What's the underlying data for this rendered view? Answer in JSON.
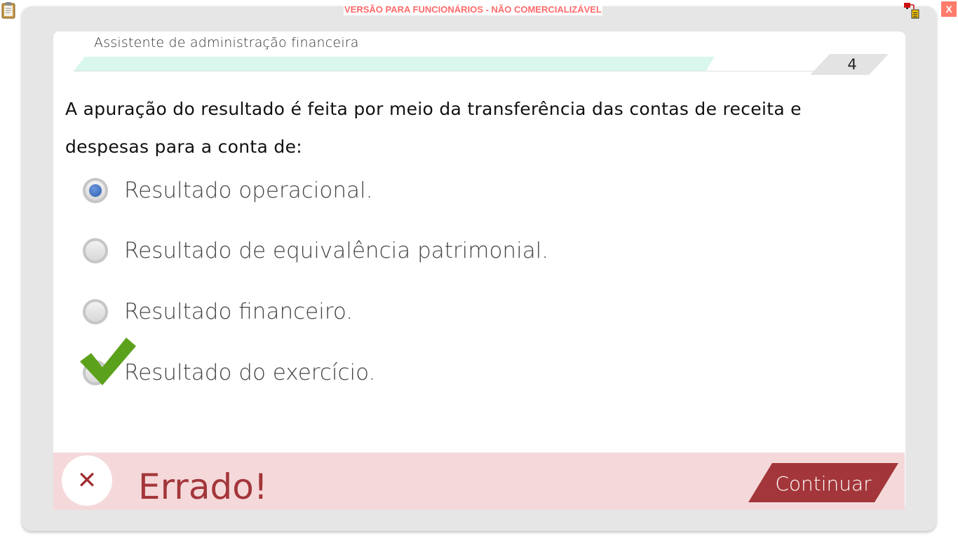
{
  "header": {
    "watermark": "VERSÃO PARA FUNCIONÁRIOS - NÃO COMERCIALIZÁVEL",
    "close_label": "X"
  },
  "course": {
    "title": "Assistente de administração financeira",
    "progress_fraction": 0.85,
    "question_number": "4"
  },
  "question": {
    "text": "A apuração do resultado é feita por meio da transferência das contas de receita e despesas para a conta de:"
  },
  "options": [
    {
      "label": "Resultado operacional.",
      "selected": true,
      "correct": false
    },
    {
      "label": "Resultado de equivalência patrimonial.",
      "selected": false,
      "correct": false
    },
    {
      "label": "Resultado financeiro.",
      "selected": false,
      "correct": false
    },
    {
      "label": "Resultado do exercício.",
      "selected": false,
      "correct": true
    }
  ],
  "feedback": {
    "status_text": "Errado!",
    "icon": "close-icon",
    "continue_label": "Continuar"
  },
  "colors": {
    "feedback_bg": "#f5d9da",
    "feedback_accent": "#a3363a",
    "progress_fill": "#d9f7ec",
    "check_green": "#5ca11b",
    "radio_selected": "#3f6fbf",
    "watermark": "#ff6b6b"
  }
}
